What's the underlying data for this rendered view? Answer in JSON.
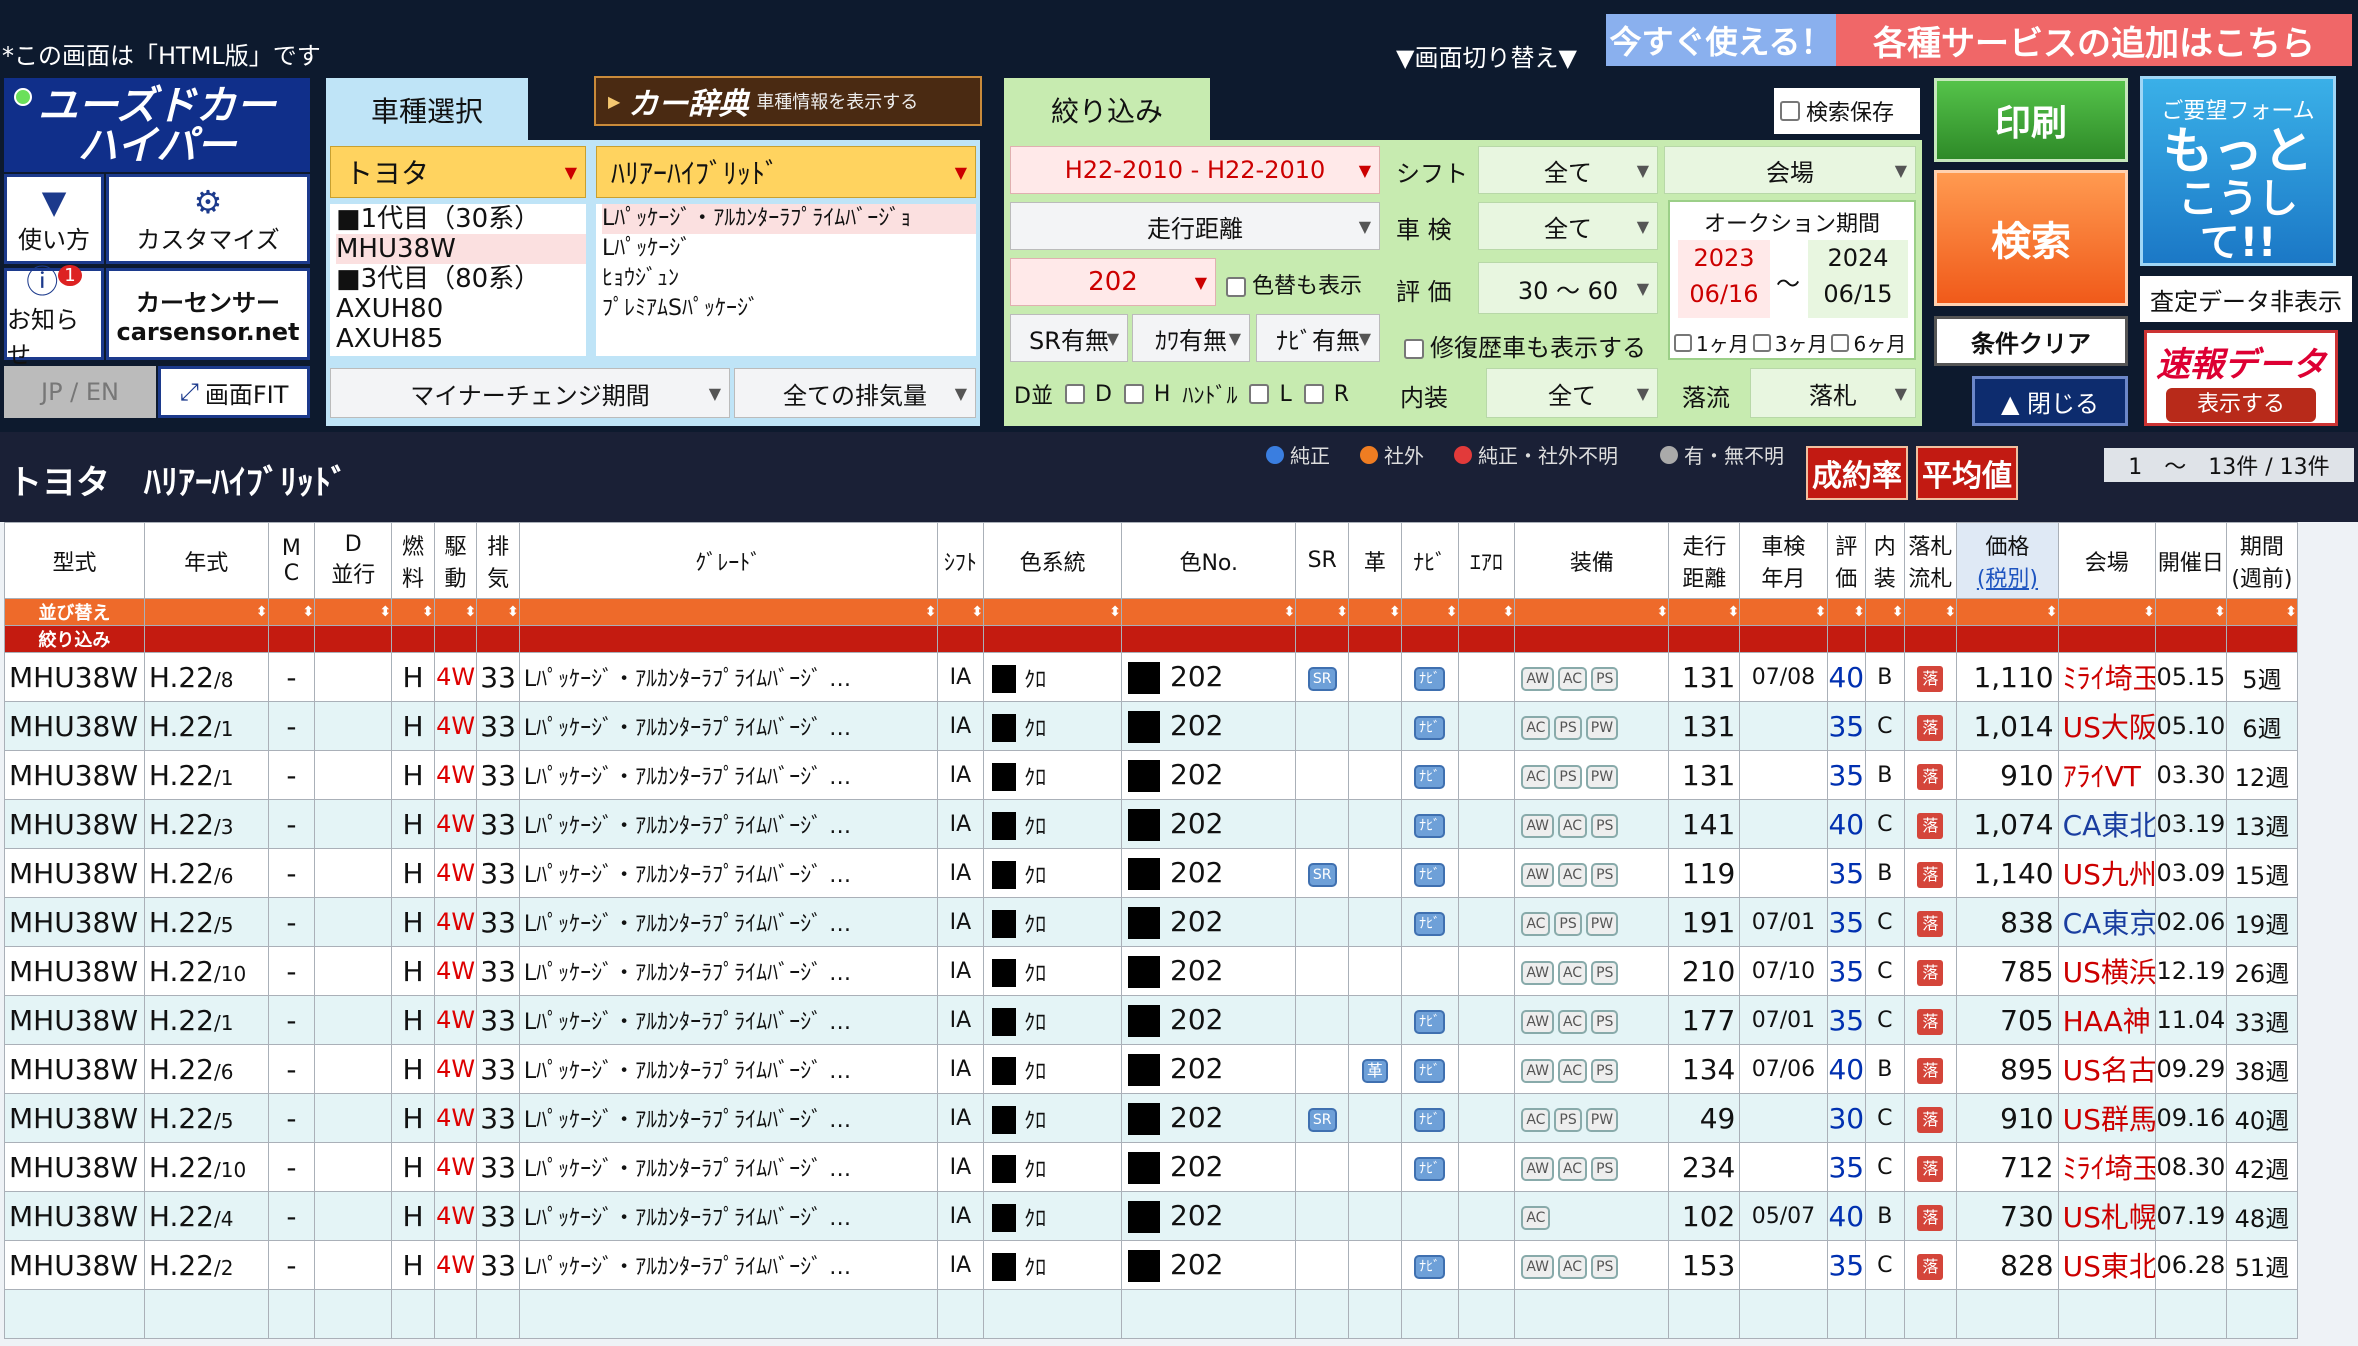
{
  "header": {
    "note": "*この画面は「HTML版」です",
    "screen_switch": "▼画面切り替え▼",
    "banner_now": "今すぐ使える！",
    "banner_add": "各種サービスの追加はこちら"
  },
  "logo": {
    "line1": "ユーズドカー",
    "line2": "ハイパー"
  },
  "side": {
    "howto": "使い方",
    "customize": "カスタマイズ",
    "news": "お知らせ",
    "news_count": "1",
    "carsensor1": "カーセンサー",
    "carsensor2": "carsensor.net",
    "lang": "JP / EN",
    "fit": "画面FIT"
  },
  "tabs": {
    "vehicle": "車種選択",
    "jiten": "カー辞典",
    "jiten_sub": "車種情報を表示する",
    "filter": "絞り込み"
  },
  "vehicle": {
    "maker": "トヨタ",
    "model": "ﾊﾘｱｰﾊｲﾌﾞﾘｯﾄﾞ",
    "type_list": [
      "■1代目（30系）",
      "MHU38W",
      "■3代目（80系）",
      "AXUH80",
      "AXUH85"
    ],
    "grade_list": [
      "Lﾊﾟｯｹｰｼﾞ・ｱﾙｶﾝﾀｰﾗﾌﾟﾗｲﾑﾊﾞｰｼﾞｮ",
      "Lﾊﾟｯｹｰｼﾞ",
      "ﾋｮｳｼﾞｭﾝ",
      "ﾌﾟﾚﾐｱﾑSﾊﾟｯｹｰｼﾞ"
    ],
    "minor_change": "マイナーチェンジ期間",
    "displacement": "全ての排気量"
  },
  "filter": {
    "year": "H22-2010 - H22-2010",
    "mileage": "走行距離",
    "color": "202",
    "color_change": "色替も表示",
    "sr": "SR有無",
    "leather": "ｶﾜ有無",
    "navi": "ﾅﾋﾞ有無",
    "d_label": "D並",
    "d_opts": [
      "D",
      "H",
      "ﾊﾝﾄﾞﾙ",
      "L",
      "R"
    ],
    "shift_label": "シフト",
    "shift": "全て",
    "venue": "会場",
    "inspect_label": "車 検",
    "inspect": "全て",
    "eval_label": "評 価",
    "eval": "30 〜 60",
    "repair": "修復歴車も表示する",
    "interior_label": "内装",
    "interior": "全て",
    "auction_label": "オークション期間",
    "from_y": "2023",
    "from_d": "06/16",
    "tilde": "〜",
    "to_y": "2024",
    "to_d": "06/15",
    "m1": "1ヶ月",
    "m3": "3ヶ月",
    "m6": "6ヶ月",
    "sold_label": "落流",
    "sold": "落札",
    "save": "検索保存"
  },
  "buttons": {
    "print": "印刷",
    "search": "検索",
    "clear": "条件クリア",
    "close": "▲ 閉じる",
    "form_top": "ご要望フォーム",
    "form_main1": "もっと",
    "form_main2": "こうして!!",
    "hide": "査定データ非表示",
    "quick": "速報データ",
    "quick_btn": "表示する"
  },
  "result": {
    "title": "トヨタ　ﾊﾘｱｰﾊｲﾌﾞﾘｯﾄﾞ",
    "legend": [
      {
        "t": "純正",
        "c": "#3a7ee0"
      },
      {
        "t": "社外",
        "c": "#ef7d22"
      },
      {
        "t": "純正・社外不明",
        "c": "#e23a3a"
      },
      {
        "t": "有・無不明",
        "c": "#aaaaaa"
      }
    ],
    "rate_btn": "成約率",
    "avg_btn": "平均値",
    "count": "1　〜　13件 / 13件"
  },
  "columns": [
    "型式",
    "年式",
    "MC",
    "D並行",
    "燃料",
    "駆動",
    "排気",
    "ｸﾞﾚｰﾄﾞ",
    "ｼﾌﾄ",
    "色系統",
    "色No.",
    "SR",
    "革",
    "ﾅﾋﾞ",
    "ｴｱﾛ",
    "装備",
    "走行距離",
    "車検年月",
    "評価",
    "内装",
    "落札流札",
    "価格(税別)",
    "会場",
    "開催日",
    "期間(週前)"
  ],
  "col_split": {
    "mc1": "M",
    "mc2": "C",
    "d1": "D",
    "d2": "並行",
    "f1": "燃",
    "f2": "料",
    "dr1": "駆",
    "dr2": "動",
    "ex1": "排",
    "ex2": "気",
    "km1": "走行",
    "km2": "距離",
    "ins1": "車検",
    "ins2": "年月",
    "ev1": "評",
    "ev2": "価",
    "in1": "内",
    "in2": "装",
    "ra1": "落札",
    "ra2": "流札",
    "pr1": "価格",
    "pr2": "(税別)",
    "wk1": "期間",
    "wk2": "(週前)"
  },
  "sort_label": "並び替え",
  "filter_label": "絞り込み",
  "rows": [
    {
      "model": "MHU38W",
      "year": "H.22",
      "mon": "/8",
      "mc": "-",
      "fuel": "H",
      "drive": "4W",
      "exh": "33",
      "grade": "Lﾊﾟｯｹｰｼﾞ・ｱﾙｶﾝﾀｰﾗﾌﾟﾗｲﾑﾊﾞｰｼﾞ …",
      "shift": "IA",
      "color": "ｸﾛ",
      "colno": "202",
      "sr": "SR",
      "leather": "",
      "navi": "ﾅﾋﾞ",
      "equip": [
        "AW",
        "AC",
        "PS"
      ],
      "km": "131",
      "insp": "07/08",
      "score": "40",
      "int": "B",
      "lot": "落",
      "price": "1,110",
      "venue": "ﾐﾗｲ埼玉",
      "date": "05.15",
      "weeks": "5週"
    },
    {
      "model": "MHU38W",
      "year": "H.22",
      "mon": "/1",
      "mc": "-",
      "fuel": "H",
      "drive": "4W",
      "exh": "33",
      "grade": "Lﾊﾟｯｹｰｼﾞ・ｱﾙｶﾝﾀｰﾗﾌﾟﾗｲﾑﾊﾞｰｼﾞ …",
      "shift": "IA",
      "color": "ｸﾛ",
      "colno": "202",
      "sr": "",
      "leather": "",
      "navi": "ﾅﾋﾞ",
      "equip": [
        "AC",
        "PS",
        "PW"
      ],
      "km": "131",
      "insp": "",
      "score": "35",
      "int": "C",
      "lot": "落",
      "price": "1,014",
      "venue": "US大阪",
      "date": "05.10",
      "weeks": "6週"
    },
    {
      "model": "MHU38W",
      "year": "H.22",
      "mon": "/1",
      "mc": "-",
      "fuel": "H",
      "drive": "4W",
      "exh": "33",
      "grade": "Lﾊﾟｯｹｰｼﾞ・ｱﾙｶﾝﾀｰﾗﾌﾟﾗｲﾑﾊﾞｰｼﾞ …",
      "shift": "IA",
      "color": "ｸﾛ",
      "colno": "202",
      "sr": "",
      "leather": "",
      "navi": "ﾅﾋﾞ",
      "equip": [
        "AC",
        "PS",
        "PW"
      ],
      "km": "131",
      "insp": "",
      "score": "35",
      "int": "B",
      "lot": "落",
      "price": "910",
      "venue": "ｱﾗｲVT",
      "date": "03.30",
      "weeks": "12週"
    },
    {
      "model": "MHU38W",
      "year": "H.22",
      "mon": "/3",
      "mc": "-",
      "fuel": "H",
      "drive": "4W",
      "exh": "33",
      "grade": "Lﾊﾟｯｹｰｼﾞ・ｱﾙｶﾝﾀｰﾗﾌﾟﾗｲﾑﾊﾞｰｼﾞ …",
      "shift": "IA",
      "color": "ｸﾛ",
      "colno": "202",
      "sr": "",
      "leather": "",
      "navi": "ﾅﾋﾞ",
      "equip": [
        "AW",
        "AC",
        "PS"
      ],
      "km": "141",
      "insp": "",
      "score": "40",
      "int": "C",
      "lot": "落",
      "price": "1,074",
      "venue": "CA東北",
      "date": "03.19",
      "weeks": "13週"
    },
    {
      "model": "MHU38W",
      "year": "H.22",
      "mon": "/6",
      "mc": "-",
      "fuel": "H",
      "drive": "4W",
      "exh": "33",
      "grade": "Lﾊﾟｯｹｰｼﾞ・ｱﾙｶﾝﾀｰﾗﾌﾟﾗｲﾑﾊﾞｰｼﾞ …",
      "shift": "IA",
      "color": "ｸﾛ",
      "colno": "202",
      "sr": "SR",
      "leather": "",
      "navi": "ﾅﾋﾞ",
      "equip": [
        "AW",
        "AC",
        "PS"
      ],
      "km": "119",
      "insp": "",
      "score": "35",
      "int": "B",
      "lot": "落",
      "price": "1,140",
      "venue": "US九州",
      "date": "03.09",
      "weeks": "15週"
    },
    {
      "model": "MHU38W",
      "year": "H.22",
      "mon": "/5",
      "mc": "-",
      "fuel": "H",
      "drive": "4W",
      "exh": "33",
      "grade": "Lﾊﾟｯｹｰｼﾞ・ｱﾙｶﾝﾀｰﾗﾌﾟﾗｲﾑﾊﾞｰｼﾞ …",
      "shift": "IA",
      "color": "ｸﾛ",
      "colno": "202",
      "sr": "",
      "leather": "",
      "navi": "ﾅﾋﾞ",
      "equip": [
        "AC",
        "PS",
        "PW"
      ],
      "km": "191",
      "insp": "07/01",
      "score": "35",
      "int": "C",
      "lot": "落",
      "price": "838",
      "venue": "CA東京",
      "date": "02.06",
      "weeks": "19週"
    },
    {
      "model": "MHU38W",
      "year": "H.22",
      "mon": "/10",
      "mc": "-",
      "fuel": "H",
      "drive": "4W",
      "exh": "33",
      "grade": "Lﾊﾟｯｹｰｼﾞ・ｱﾙｶﾝﾀｰﾗﾌﾟﾗｲﾑﾊﾞｰｼﾞ …",
      "shift": "IA",
      "color": "ｸﾛ",
      "colno": "202",
      "sr": "",
      "leather": "",
      "navi": "",
      "equip": [
        "AW",
        "AC",
        "PS"
      ],
      "km": "210",
      "insp": "07/10",
      "score": "35",
      "int": "C",
      "lot": "落",
      "price": "785",
      "venue": "US横浜",
      "date": "12.19",
      "weeks": "26週"
    },
    {
      "model": "MHU38W",
      "year": "H.22",
      "mon": "/1",
      "mc": "-",
      "fuel": "H",
      "drive": "4W",
      "exh": "33",
      "grade": "Lﾊﾟｯｹｰｼﾞ・ｱﾙｶﾝﾀｰﾗﾌﾟﾗｲﾑﾊﾞｰｼﾞ …",
      "shift": "IA",
      "color": "ｸﾛ",
      "colno": "202",
      "sr": "",
      "leather": "",
      "navi": "ﾅﾋﾞ",
      "equip": [
        "AW",
        "AC",
        "PS"
      ],
      "km": "177",
      "insp": "07/01",
      "score": "35",
      "int": "C",
      "lot": "落",
      "price": "705",
      "venue": "HAA神",
      "date": "11.04",
      "weeks": "33週"
    },
    {
      "model": "MHU38W",
      "year": "H.22",
      "mon": "/6",
      "mc": "-",
      "fuel": "H",
      "drive": "4W",
      "exh": "33",
      "grade": "Lﾊﾟｯｹｰｼﾞ・ｱﾙｶﾝﾀｰﾗﾌﾟﾗｲﾑﾊﾞｰｼﾞ …",
      "shift": "IA",
      "color": "ｸﾛ",
      "colno": "202",
      "sr": "",
      "leather": "革",
      "navi": "ﾅﾋﾞ",
      "equip": [
        "AW",
        "AC",
        "PS"
      ],
      "km": "134",
      "insp": "07/06",
      "score": "40",
      "int": "B",
      "lot": "落",
      "price": "895",
      "venue": "US名古",
      "date": "09.29",
      "weeks": "38週"
    },
    {
      "model": "MHU38W",
      "year": "H.22",
      "mon": "/5",
      "mc": "-",
      "fuel": "H",
      "drive": "4W",
      "exh": "33",
      "grade": "Lﾊﾟｯｹｰｼﾞ・ｱﾙｶﾝﾀｰﾗﾌﾟﾗｲﾑﾊﾞｰｼﾞ …",
      "shift": "IA",
      "color": "ｸﾛ",
      "colno": "202",
      "sr": "SR",
      "leather": "",
      "navi": "ﾅﾋﾞ",
      "equip": [
        "AC",
        "PS",
        "PW"
      ],
      "km": "49",
      "insp": "",
      "score": "30",
      "int": "C",
      "lot": "落",
      "price": "910",
      "venue": "US群馬",
      "date": "09.16",
      "weeks": "40週"
    },
    {
      "model": "MHU38W",
      "year": "H.22",
      "mon": "/10",
      "mc": "-",
      "fuel": "H",
      "drive": "4W",
      "exh": "33",
      "grade": "Lﾊﾟｯｹｰｼﾞ・ｱﾙｶﾝﾀｰﾗﾌﾟﾗｲﾑﾊﾞｰｼﾞ …",
      "shift": "IA",
      "color": "ｸﾛ",
      "colno": "202",
      "sr": "",
      "leather": "",
      "navi": "ﾅﾋﾞ",
      "equip": [
        "AW",
        "AC",
        "PS"
      ],
      "km": "234",
      "insp": "",
      "score": "35",
      "int": "C",
      "lot": "落",
      "price": "712",
      "venue": "ﾐﾗｲ埼玉",
      "date": "08.30",
      "weeks": "42週"
    },
    {
      "model": "MHU38W",
      "year": "H.22",
      "mon": "/4",
      "mc": "-",
      "fuel": "H",
      "drive": "4W",
      "exh": "33",
      "grade": "Lﾊﾟｯｹｰｼﾞ・ｱﾙｶﾝﾀｰﾗﾌﾟﾗｲﾑﾊﾞｰｼﾞ …",
      "shift": "IA",
      "color": "ｸﾛ",
      "colno": "202",
      "sr": "",
      "leather": "",
      "navi": "",
      "equip": [
        "AC"
      ],
      "km": "102",
      "insp": "05/07",
      "score": "40",
      "int": "B",
      "lot": "落",
      "price": "730",
      "venue": "US札幌",
      "date": "07.19",
      "weeks": "48週"
    },
    {
      "model": "MHU38W",
      "year": "H.22",
      "mon": "/2",
      "mc": "-",
      "fuel": "H",
      "drive": "4W",
      "exh": "33",
      "grade": "Lﾊﾟｯｹｰｼﾞ・ｱﾙｶﾝﾀｰﾗﾌﾟﾗｲﾑﾊﾞｰｼﾞ …",
      "shift": "IA",
      "color": "ｸﾛ",
      "colno": "202",
      "sr": "",
      "leather": "",
      "navi": "ﾅﾋﾞ",
      "equip": [
        "AW",
        "AC",
        "PS"
      ],
      "km": "153",
      "insp": "",
      "score": "35",
      "int": "C",
      "lot": "落",
      "price": "828",
      "venue": "US東北",
      "date": "06.28",
      "weeks": "51週"
    }
  ]
}
